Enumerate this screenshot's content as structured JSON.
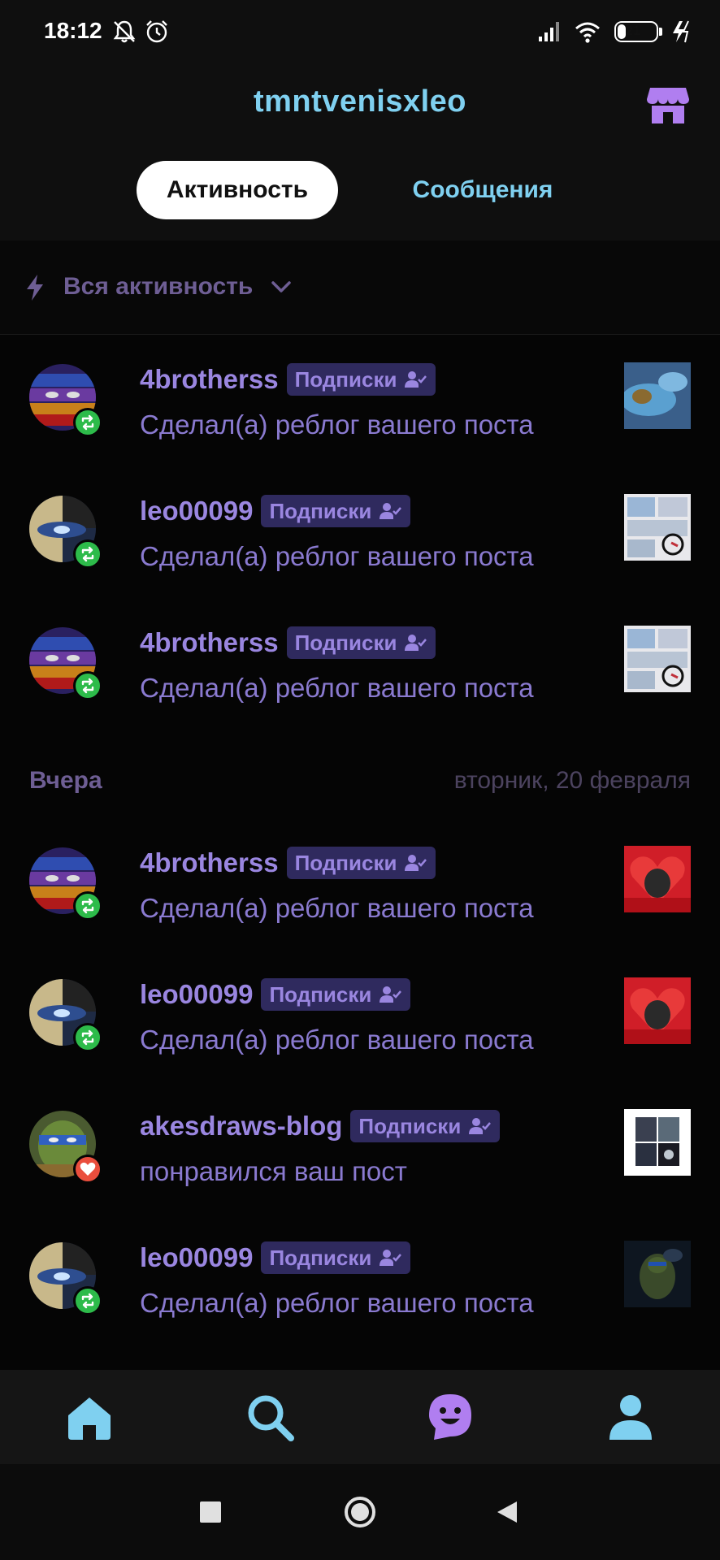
{
  "status_bar": {
    "time": "18:12",
    "battery": "21",
    "battery_level": 0.21,
    "icons": [
      "bell-off-icon",
      "alarm-icon",
      "signal-icon",
      "wifi-icon",
      "battery-icon",
      "charging-icon"
    ]
  },
  "header": {
    "title": "tmntvenisxleo",
    "shop_icon": "shop-icon"
  },
  "tabs": [
    {
      "label": "Активность",
      "active": true
    },
    {
      "label": "Сообщения",
      "active": false
    }
  ],
  "filter": {
    "icon": "bolt-icon",
    "label": "Вся активность"
  },
  "items_today": [
    {
      "username": "4brotherss",
      "tag": "Подписки",
      "action": "Сделал(а) реблог вашего поста",
      "type": "reblog",
      "avatar": "tmnt-masks",
      "thumb": "blue-close-up"
    },
    {
      "username": "leo00099",
      "tag": "Подписки",
      "action": "Сделал(а) реблог вашего поста",
      "type": "reblog",
      "avatar": "leo-eyes",
      "thumb": "comic-page"
    },
    {
      "username": "4brotherss",
      "tag": "Подписки",
      "action": "Сделал(а) реблог вашего поста",
      "type": "reblog",
      "avatar": "tmnt-masks",
      "thumb": "comic-page"
    }
  ],
  "section": {
    "left": "Вчера",
    "right": "вторник, 20 февраля"
  },
  "items_yesterday": [
    {
      "username": "4brotherss",
      "tag": "Подписки",
      "action": "Сделал(а) реблог вашего поста",
      "type": "reblog",
      "avatar": "tmnt-masks",
      "thumb": "red-heart"
    },
    {
      "username": "leo00099",
      "tag": "Подписки",
      "action": "Сделал(а) реблог вашего поста",
      "type": "reblog",
      "avatar": "leo-eyes",
      "thumb": "red-heart"
    },
    {
      "username": "akesdraws-blog",
      "tag": "Подписки",
      "action": "понравился ваш пост",
      "type": "like",
      "avatar": "turtle-green",
      "thumb": "white-collage"
    },
    {
      "username": "leo00099",
      "tag": "Подписки",
      "action": "Сделал(а) реблог вашего поста",
      "type": "reblog",
      "avatar": "leo-eyes",
      "thumb": "dark-turtle"
    }
  ],
  "bottom_nav": [
    "home-icon",
    "search-icon",
    "activity-smile-icon",
    "profile-icon"
  ],
  "system_nav": [
    "recents-icon",
    "home-circle-icon",
    "back-icon"
  ],
  "colors": {
    "accent_blue": "#7fd0f0",
    "username_purple": "#9a86e0",
    "action_purple": "#8a7ad0",
    "pill_bg": "#2f2a5e",
    "reblog_green": "#2dbb4a",
    "like_red": "#ea4e3d"
  }
}
